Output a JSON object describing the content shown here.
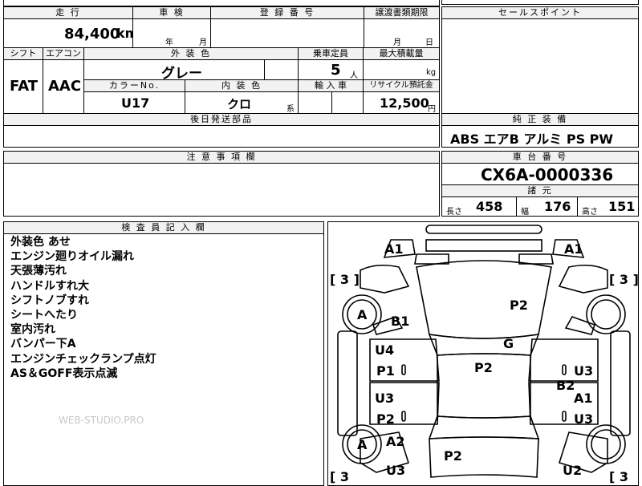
{
  "top_partial": {
    "left": "",
    "mid": "",
    "right": ""
  },
  "headers": {
    "mileage": "走 行",
    "inspection": "車 検",
    "registration": "登 録 番 号",
    "transfer_deadline": "譲渡書類期限",
    "sales_point": "セールスポイント",
    "shift": "シフト",
    "aircon": "エアコン",
    "exterior_color": "外 装 色",
    "capacity": "乗車定員",
    "max_load": "最大積載量",
    "color_no": "カラーNo.",
    "interior_color": "内 装 色",
    "import": "輸 入 車",
    "recycle": "リサイクル預託金",
    "later_parts": "後日発送部品",
    "equipment": "純 正 装 備",
    "notes": "注 意 事 項 欄",
    "chassis_no": "車 台 番 号",
    "specs": "諸 元",
    "inspector": "検 査 員 記 入 欄"
  },
  "values": {
    "mileage": "84,400",
    "mileage_unit": "km",
    "inspection_year": "年",
    "inspection_month": "月",
    "transfer_month": "月",
    "transfer_day": "日",
    "shift": "FAT",
    "aircon": "AAC",
    "exterior_color": "グレー",
    "capacity": "5",
    "capacity_unit": "人",
    "load_unit": "kg",
    "color_no": "U17",
    "interior_color": "クロ",
    "interior_suffix": "系",
    "recycle": "12,500",
    "recycle_unit": "円",
    "equipment": "ABS エアB アルミ PS PW",
    "chassis_no": "CX6A-0000336",
    "length_label": "長さ",
    "length": "458",
    "width_label": "幅",
    "width": "176",
    "height_label": "高さ",
    "height": "151"
  },
  "inspector_notes": [
    "外装色 あせ",
    "エンジン廻りオイル漏れ",
    "天張薄汚れ",
    "ハンドルすれ大",
    "シフトノブすれ",
    "シートへたり",
    "室内汚れ",
    "バンパー下A",
    "エンジンチェックランプ点灯",
    "AS＆GOFF表示点滅"
  ],
  "diagram_labels": {
    "a1_left": "A1",
    "a1_right": "A1",
    "tire_tl": "[ 3 ]",
    "tire_tr": "[ 3 ]",
    "tire_bl": "[ 3",
    "tire_br": "[ 3",
    "wheel_a_top": "A",
    "wheel_a_bottom": "A",
    "b1": "B1",
    "p2_hood": "P2",
    "g": "G",
    "p2_roof": "P2",
    "u4": "U4",
    "p1": "P1",
    "u3_left1": "U3",
    "p2_left": "P2",
    "u3_right1": "U3",
    "b2": "B2",
    "a1_rightdoor": "A1",
    "u3_right2": "U3",
    "a2": "A2",
    "p2_trunk": "P2",
    "u3_bottom": "U3",
    "u2": "U2"
  },
  "watermark": "WEB-STUDIO.PRO"
}
